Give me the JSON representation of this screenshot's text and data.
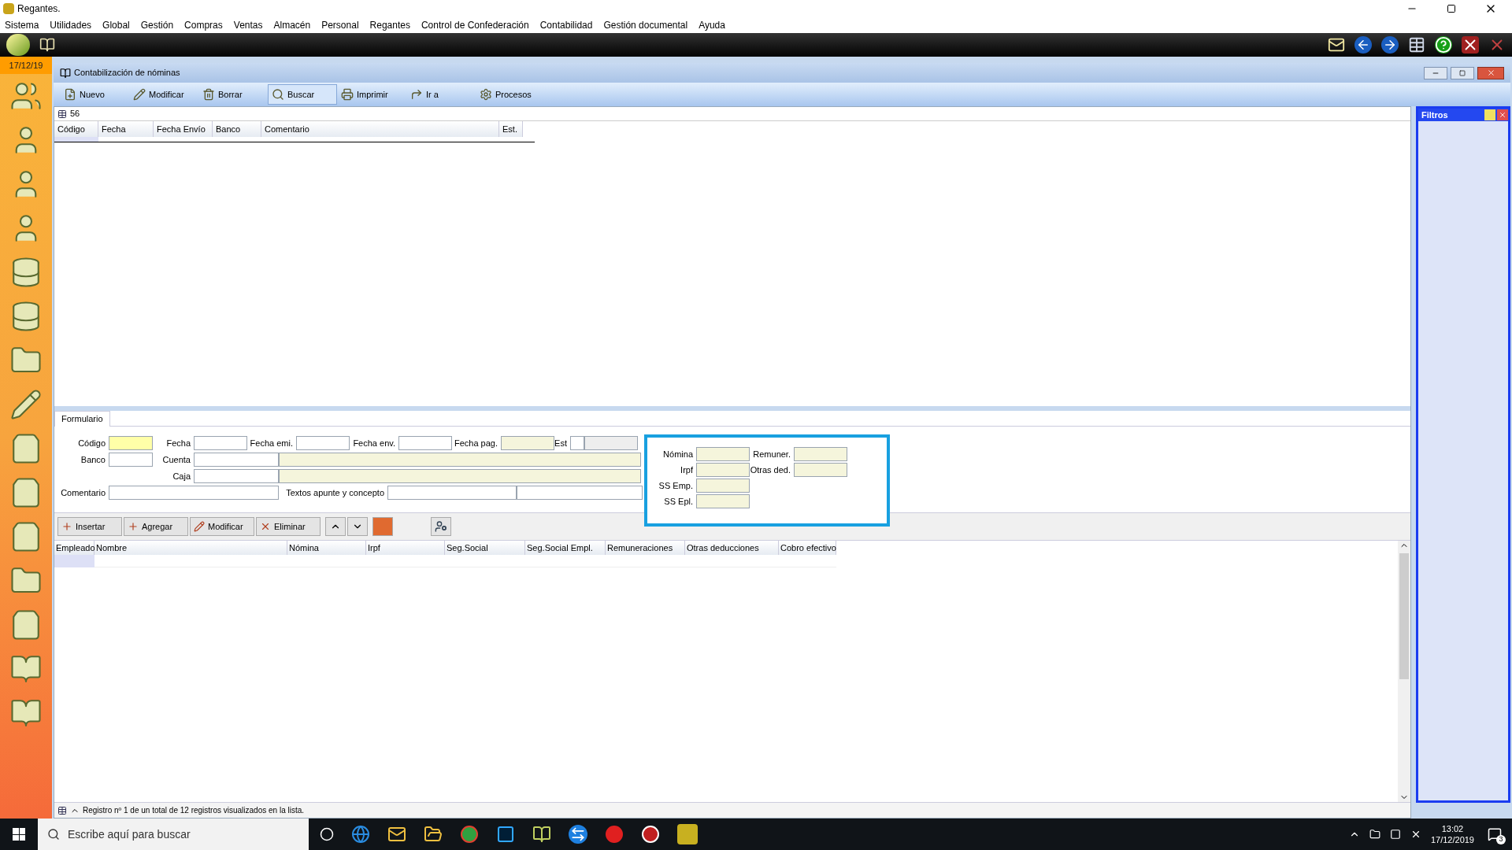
{
  "app_title": "Regantes.",
  "menu": [
    "Sistema",
    "Utilidades",
    "Global",
    "Gestión",
    "Compras",
    "Ventas",
    "Almacén",
    "Personal",
    "Regantes",
    "Control de Confederación",
    "Contabilidad",
    "Gestión documental",
    "Ayuda"
  ],
  "date": "17/12/19",
  "window": {
    "title": "Contabilización de nóminas"
  },
  "toolbar": [
    {
      "label": "Nuevo",
      "selected": false
    },
    {
      "label": "Modificar",
      "selected": false
    },
    {
      "label": "Borrar",
      "selected": false
    },
    {
      "label": "Buscar",
      "selected": true
    },
    {
      "label": "Imprimir",
      "selected": false
    },
    {
      "label": "Ir a",
      "selected": false
    },
    {
      "label": "Procesos",
      "selected": false
    }
  ],
  "record_count": "56",
  "top_table": {
    "columns": [
      "Código",
      "Fecha",
      "Fecha Envío",
      "Banco",
      "Comentario",
      "Est."
    ]
  },
  "filters_panel": {
    "title": "Filtros"
  },
  "form_tab": "Formulario",
  "form": {
    "labels": [
      "Código",
      "Fecha",
      "Fecha emi.",
      "Fecha env.",
      "Fecha pag.",
      "Est",
      "Banco",
      "Cuenta",
      "Caja",
      "Comentario",
      "Textos apunte y concepto"
    ],
    "totals_labels": [
      "Nómina",
      "Remuner.",
      "Irpf",
      "Otras ded.",
      "SS Emp.",
      "SS Epl."
    ]
  },
  "line_buttons": [
    "Insertar",
    "Agregar",
    "Modificar",
    "Eliminar"
  ],
  "lower_table": {
    "columns": [
      "Empleado",
      "Nombre",
      "Nómina",
      "Irpf",
      "Seg.Social",
      "Seg.Social Empl.",
      "Remuneraciones",
      "Otras deducciones",
      "Cobro efectivo"
    ]
  },
  "status_bar": "Registro nº 1 de un total de 12 registros visualizados en la lista.",
  "taskbar": {
    "search_placeholder": "Escribe aquí para buscar",
    "time": "13:02",
    "date": "17/12/2019",
    "notifications": "3"
  }
}
